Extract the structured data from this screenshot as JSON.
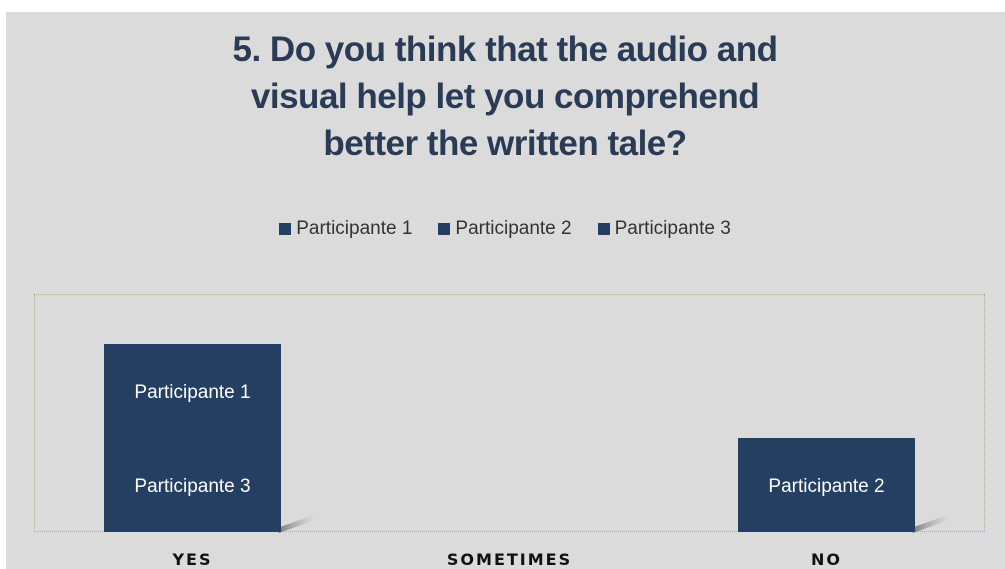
{
  "chart_data": {
    "type": "bar",
    "title_lines": [
      "5. Do you think that the audio and",
      "visual help let you comprehend",
      "better the written tale?"
    ],
    "categories": [
      "YES",
      "SOMETIMES",
      "NO"
    ],
    "series": [
      {
        "name": "Participante 1",
        "values": [
          1,
          0,
          0
        ]
      },
      {
        "name": "Participante 2",
        "values": [
          0,
          0,
          1
        ]
      },
      {
        "name": "Participante 3",
        "values": [
          1,
          0,
          0
        ]
      }
    ],
    "stacked": true,
    "data_labels": [
      {
        "category": "YES",
        "text": "Participante 1"
      },
      {
        "category": "YES",
        "text": "Participante 3"
      },
      {
        "category": "NO",
        "text": "Participante 2"
      }
    ],
    "legend_position": "top",
    "grid": false,
    "colors": {
      "bar": "#243f61",
      "background": "#dbdbdb",
      "title": "#2a3b55"
    }
  }
}
